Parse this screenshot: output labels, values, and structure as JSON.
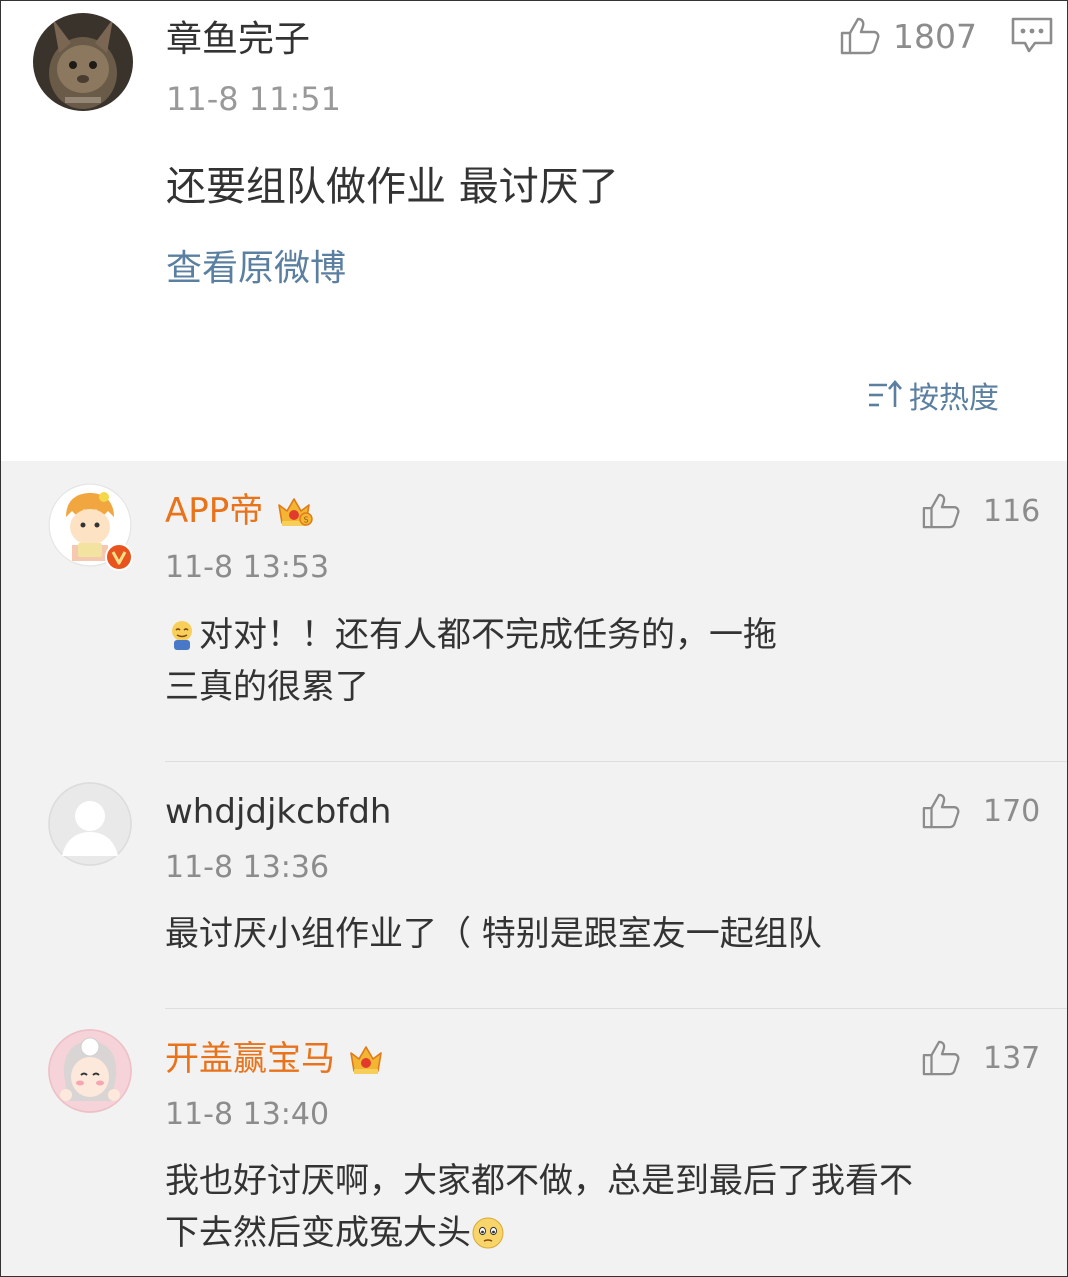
{
  "post": {
    "author": "章鱼完子",
    "time": "11-8 11:51",
    "likes": "1807",
    "content": "还要组队做作业 最讨厌了",
    "view_original": "查看原微博",
    "sort_label": "按热度"
  },
  "comments": [
    {
      "author": "APP帝",
      "verified": true,
      "vip_crown": true,
      "time": "11-8 13:53",
      "likes": "116",
      "text": "对对！！还有人都不完成任务的，一拖",
      "text_line2": "三真的很累了"
    },
    {
      "author": "whdjdjkcbfdh",
      "time": "11-8 13:36",
      "likes": "170",
      "text": "最讨厌小组作业了（ 特别是跟室友一起组队"
    },
    {
      "author": "开盖赢宝马",
      "vip_crown": true,
      "time": "11-8 13:40",
      "likes": "137",
      "text": "我也好讨厌啊，大家都不做，总是到最后了我看不",
      "text_line2": "下去然后变成冤大头"
    }
  ],
  "colors": {
    "vip_name": "#e8731a",
    "link": "#5b7fa0",
    "meta": "#999999",
    "comment_bg": "#f2f2f2"
  },
  "icons": [
    "thumbs-up-icon",
    "more-comment-icon",
    "sort-icon",
    "crown-icon",
    "verified-badge-icon",
    "emoji-icon"
  ]
}
